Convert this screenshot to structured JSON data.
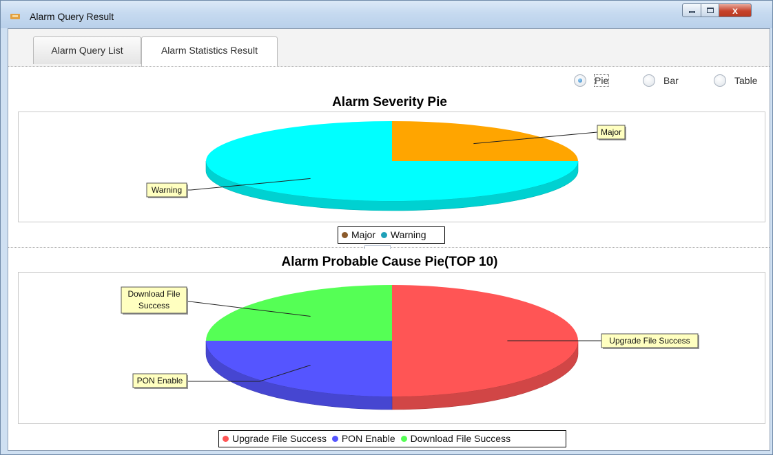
{
  "window": {
    "title": "Alarm Query Result",
    "controls": {
      "close_glyph": "x"
    }
  },
  "tabs": [
    {
      "label": "Alarm Query List",
      "selected": false
    },
    {
      "label": "Alarm Statistics Result",
      "selected": true
    }
  ],
  "view_options": [
    {
      "label": "Pie",
      "selected": true
    },
    {
      "label": "Bar",
      "selected": false
    },
    {
      "label": "Table",
      "selected": false
    }
  ],
  "chart_data": [
    {
      "type": "pie",
      "title": "Alarm Severity Pie",
      "style": "3d",
      "categories": [
        "Major",
        "Warning"
      ],
      "values": [
        25,
        75
      ],
      "colors": [
        "#ffa500",
        "#00ffff"
      ],
      "legend_colors": [
        "#8b5a2b",
        "#1fa0b8"
      ],
      "legend_position": "bottom"
    },
    {
      "type": "pie",
      "title": "Alarm Probable Cause Pie(TOP 10)",
      "style": "3d",
      "categories": [
        "Upgrade File Success",
        "PON Enable",
        "Download File Success"
      ],
      "values": [
        50,
        25,
        25
      ],
      "colors": [
        "#ff5555",
        "#5555ff",
        "#55ff55"
      ],
      "legend_colors": [
        "#ff5555",
        "#5555ff",
        "#55ff55"
      ],
      "legend_position": "bottom"
    }
  ]
}
